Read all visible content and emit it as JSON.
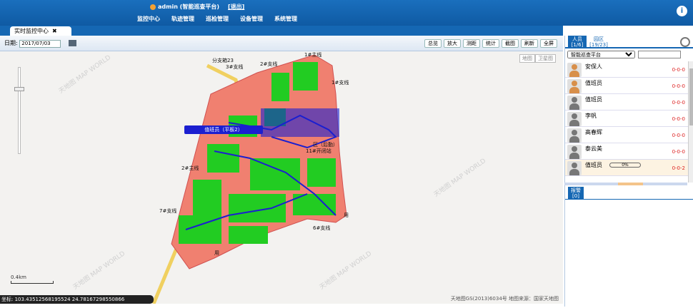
{
  "header": {
    "username": "admin (智能巡查平台)",
    "logout": "[退出]",
    "nav": [
      "监控中心",
      "轨迹管理",
      "巡检管理",
      "设备管理",
      "系统管理"
    ]
  },
  "tab": {
    "label": "实时监控中心",
    "close": "✖"
  },
  "toolbar": {
    "date_label": "日期:",
    "date_value": "2017/07/03",
    "tools": [
      "总览",
      "放大",
      "测距",
      "统计",
      "截图",
      "刷新",
      "全屏"
    ]
  },
  "map": {
    "type_buttons": [
      "地图",
      "卫星图"
    ],
    "popup": "值班员（平板2）",
    "labels": [
      "分支箱23",
      "1#主线",
      "2#支线",
      "3#支线",
      "1#支线",
      "2#主线",
      "7#支线",
      "6#支线",
      "11#开闭站",
      "区（后勤）",
      "用",
      "用"
    ],
    "scale": "0.4km",
    "copyright": "天地图GS(2013)6034号 地图来源：国家天地图",
    "watermark": "天地图 MAP WORLD",
    "coords_label": "坐标:",
    "coords": "103.43512568195524 24.78167298550866"
  },
  "right_panel": {
    "tabs": [
      {
        "label": "人员",
        "count": "[1/6]"
      },
      {
        "label": "园区",
        "count": "[19/23]"
      }
    ],
    "filter_value": "智能巡查平台",
    "people": [
      {
        "name": "安保人",
        "status": "0-0-0",
        "online": true
      },
      {
        "name": "值班员",
        "status": "0-0-0",
        "online": true
      },
      {
        "name": "值班员",
        "status": "0-0-0",
        "online": false
      },
      {
        "name": "李帆",
        "status": "0-0-0",
        "online": false
      },
      {
        "name": "高春辉",
        "status": "0-0-0",
        "online": false
      },
      {
        "name": "泰云美",
        "status": "0-0-0",
        "online": false
      },
      {
        "name": "值班员",
        "status": "0-0-2",
        "online": false,
        "progress": "0%"
      }
    ],
    "alarm": {
      "label": "报警",
      "count": "[0]"
    }
  },
  "colors": {
    "primary": "#1567b3",
    "zone": "#f08070",
    "buildings": "#22cc22",
    "track": "#1b1fd0",
    "road": "#f0d060"
  }
}
